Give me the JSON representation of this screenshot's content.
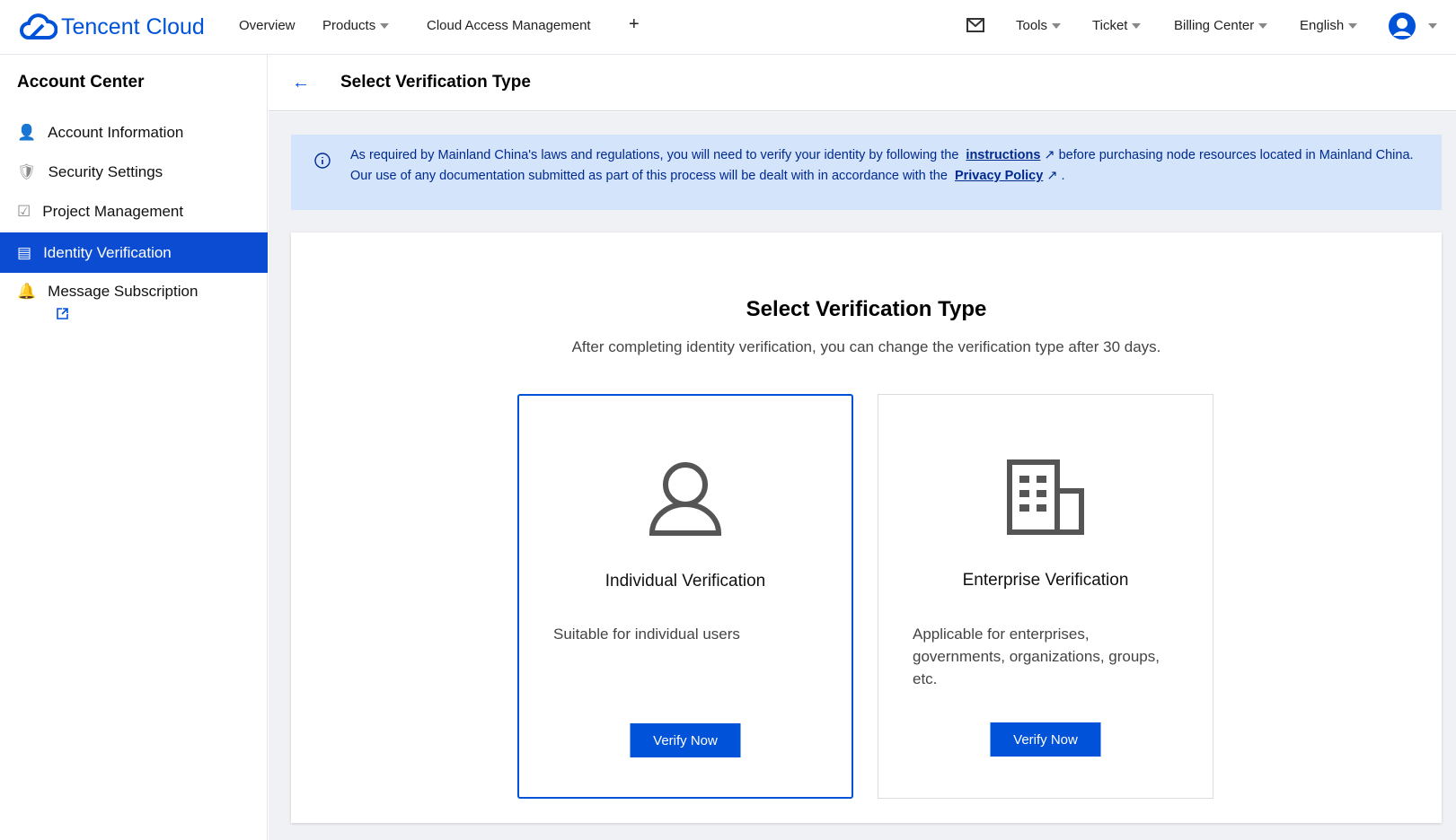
{
  "header": {
    "brand": "Tencent Cloud",
    "nav": [
      "Overview",
      "Products",
      "Cloud Access Management"
    ],
    "right": [
      "Tools",
      "Ticket",
      "Billing Center",
      "English"
    ]
  },
  "sidebar": {
    "title": "Account Center",
    "items": [
      {
        "label": "Account Information"
      },
      {
        "label": "Security Settings"
      },
      {
        "label": "Project Management"
      },
      {
        "label": "Identity Verification"
      },
      {
        "label": "Message Subscription"
      }
    ]
  },
  "page": {
    "title": "Select Verification Type"
  },
  "notice": {
    "part1": "As required by Mainland China's laws and regulations, you will need to verify your identity by following the",
    "link1": "instructions",
    "part2": "before purchasing node resources located in Mainland China. Our use of any documentation submitted as part of this process will be dealt with in accordance with the",
    "link2": "Privacy Policy",
    "part3": "."
  },
  "panel": {
    "title": "Select Verification Type",
    "subtitle": "After completing identity verification, you can change the verification type after 30 days.",
    "cards": [
      {
        "name": "Individual Verification",
        "desc": "Suitable for individual users",
        "button": "Verify Now"
      },
      {
        "name": "Enterprise Verification",
        "desc": "Applicable for enterprises, governments, organizations, groups, etc.",
        "button": "Verify Now"
      }
    ]
  },
  "colors": {
    "brand": "#0052d9",
    "active": "#0b4cd2",
    "notice_bg": "#d4e4fb"
  }
}
